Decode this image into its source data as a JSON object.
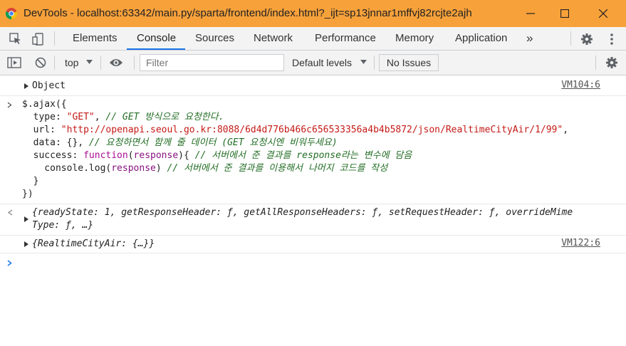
{
  "window": {
    "title": "DevTools - localhost:63342/main.py/sparta/frontend/index.html?_ijt=sp13jnnar1mffvj82rcjte2ajh",
    "minimize_icon": "minimize-icon",
    "maximize_icon": "maximize-icon",
    "close_icon": "close-icon"
  },
  "tabs": {
    "items": [
      "Elements",
      "Console",
      "Sources",
      "Network",
      "Performance",
      "Memory",
      "Application"
    ],
    "active": "Console",
    "more": "»"
  },
  "toolbar": {
    "context": "top",
    "filter_placeholder": "Filter",
    "levels": "Default levels",
    "issues": "No Issues"
  },
  "console": {
    "object_row": {
      "label": "Object",
      "source": "VM104:6"
    },
    "code": {
      "l1": "$.ajax({",
      "l2_key": "  type: ",
      "l2_val": "\"GET\"",
      "l2_rest": ", ",
      "l2_cmt": "// GET 방식으로 요청한다.",
      "l3_key": "  url: ",
      "l3_val": "\"http://openapi.seoul.go.kr:8088/6d4d776b466c656533356a4b4b5872/json/RealtimeCityAir/1/99\"",
      "l3_rest": ",",
      "l4_key": "  data: {}, ",
      "l4_cmt": "// 요청하면서 함께 줄 데이터 (GET 요청시엔 비워두세요)",
      "l5_key": "  success: ",
      "l5_fn": "function",
      "l5_a": "(",
      "l5_param": "response",
      "l5_b": "){ ",
      "l5_cmt": "// 서버에서 준 결과를 response라는 변수에 담음",
      "l6_a": "    console.log(",
      "l6_param": "response",
      "l6_b": ") ",
      "l6_cmt": "// 서버에서 준 결과를 이용해서 나머지 코드를 작성",
      "l7": "  }",
      "l8": "})"
    },
    "result": {
      "l1": "{readyState: 1, getResponseHeader: ƒ, getAllResponseHeaders: ƒ, setRequestHeader: ƒ, overrideMime",
      "l2": "Type: ƒ, …}"
    },
    "air_row": {
      "label": "{RealtimeCityAir: {…}}",
      "source": "VM122:6"
    }
  },
  "colors": {
    "titlebar": "#f7a13a",
    "accent": "#1a73e8",
    "string": "#c41a16",
    "comment": "#236e25",
    "keyword": "#aa0d91"
  }
}
